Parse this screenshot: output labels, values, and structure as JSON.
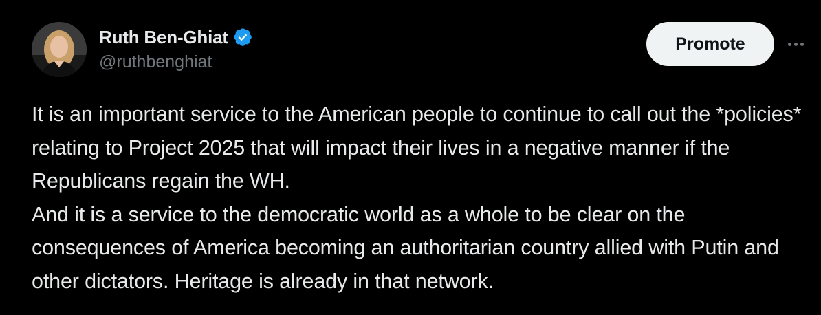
{
  "author": {
    "display_name": "Ruth Ben-Ghiat",
    "handle": "@ruthbenghiat",
    "verified": true,
    "verified_color": "#1d9bf0"
  },
  "actions": {
    "promote_label": "Promote",
    "more_icon": "more-horizontal-icon"
  },
  "tweet": {
    "paragraphs": [
      "It is an important service to the American people to continue to call out the *policies* relating to Project 2025 that will impact their lives in a negative manner if the Republicans regain the WH.",
      "And it is a service to the democratic world as a whole to be clear on the consequences of America becoming an authoritarian country allied with Putin and other dictators. Heritage is already in that network."
    ]
  },
  "colors": {
    "background": "#000000",
    "text_primary": "#e7e9ea",
    "text_secondary": "#71767b",
    "button_bg": "#eff3f4",
    "button_text": "#0f1419"
  }
}
